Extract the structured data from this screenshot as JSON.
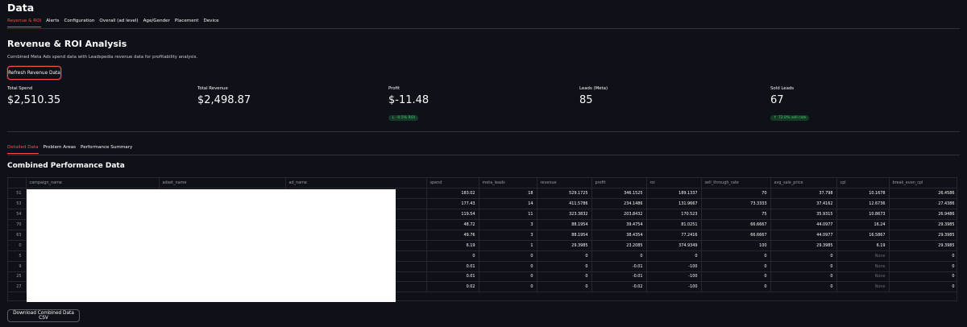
{
  "page": {
    "title": "Data"
  },
  "tabs": [
    {
      "label": "Revenue & ROI",
      "active": true
    },
    {
      "label": "Alerts",
      "active": false
    },
    {
      "label": "Configuration",
      "active": false
    },
    {
      "label": "Overall (ad level)",
      "active": false
    },
    {
      "label": "Age/Gender",
      "active": false
    },
    {
      "label": "Placement",
      "active": false
    },
    {
      "label": "Device",
      "active": false
    }
  ],
  "section": {
    "title": "Revenue & ROI Analysis",
    "description": "Combined Meta Ads spend data with Leadspedia revenue data for profitability analysis.",
    "refresh_button": "Refresh Revenue Data"
  },
  "metrics": [
    {
      "label": "Total Spend",
      "value": "$2,510.35"
    },
    {
      "label": "Total Revenue",
      "value": "$2,498.87"
    },
    {
      "label": "Profit",
      "value": "$-11.48",
      "delta": "-0.5% ROI",
      "delta_arrow": "↓"
    },
    {
      "label": "Leads (Meta)",
      "value": "85"
    },
    {
      "label": "Sold Leads",
      "value": "67",
      "delta": "72.0% sell rate",
      "delta_arrow": "↑"
    }
  ],
  "subtabs": [
    {
      "label": "Detailed Data",
      "active": true
    },
    {
      "label": "Problem Areas",
      "active": false
    },
    {
      "label": "Performance Summary",
      "active": false
    }
  ],
  "table": {
    "title": "Combined Performance Data",
    "columns": [
      "",
      "campaign_name",
      "adset_name",
      "ad_name",
      "spend",
      "meta_leads",
      "revenue",
      "profit",
      "roi",
      "sell_through_rate",
      "avg_sale_price",
      "cpl",
      "break_even_cpl"
    ],
    "rows": [
      [
        "51",
        "",
        "",
        "",
        "183.02",
        "18",
        "529.1725",
        "346.1525",
        "189.1337",
        "70",
        "37.798",
        "10.1678",
        "26.4586"
      ],
      [
        "53",
        "",
        "",
        "",
        "177.43",
        "14",
        "411.5786",
        "234.1486",
        "131.9667",
        "73.3333",
        "37.4162",
        "12.6736",
        "27.4386"
      ],
      [
        "54",
        "",
        "",
        "",
        "119.54",
        "11",
        "323.3832",
        "203.8432",
        "170.523",
        "75",
        "35.9315",
        "10.8673",
        "26.9486"
      ],
      [
        "70",
        "",
        "",
        "",
        "48.72",
        "3",
        "88.1954",
        "39.4754",
        "81.0251",
        "66.6667",
        "44.0977",
        "16.24",
        "29.3985"
      ],
      [
        "63",
        "",
        "",
        "",
        "49.76",
        "3",
        "88.1954",
        "38.4354",
        "77.2416",
        "66.6667",
        "44.0977",
        "16.5867",
        "29.3985"
      ],
      [
        "0",
        "",
        "",
        "",
        "6.19",
        "1",
        "29.3985",
        "23.2085",
        "374.9349",
        "100",
        "29.3985",
        "6.19",
        "29.3985"
      ],
      [
        "5",
        "",
        "",
        "",
        "0",
        "0",
        "0",
        "0",
        "0",
        "0",
        "0",
        "None",
        "0"
      ],
      [
        "9",
        "",
        "",
        "",
        "0.01",
        "0",
        "0",
        "-0.01",
        "-100",
        "0",
        "0",
        "None",
        "0"
      ],
      [
        "25",
        "",
        "",
        "",
        "0.01",
        "0",
        "0",
        "-0.01",
        "-100",
        "0",
        "0",
        "None",
        "0"
      ],
      [
        "27",
        "",
        "",
        "",
        "0.02",
        "0",
        "0",
        "-0.02",
        "-100",
        "0",
        "0",
        "None",
        "0"
      ]
    ]
  },
  "download_button": "Download Combined Data CSV",
  "colors": {
    "background": "#0e1117",
    "accent": "#ff4b4b",
    "delta_bg": "#173928",
    "delta_fg": "#3dd56d"
  }
}
